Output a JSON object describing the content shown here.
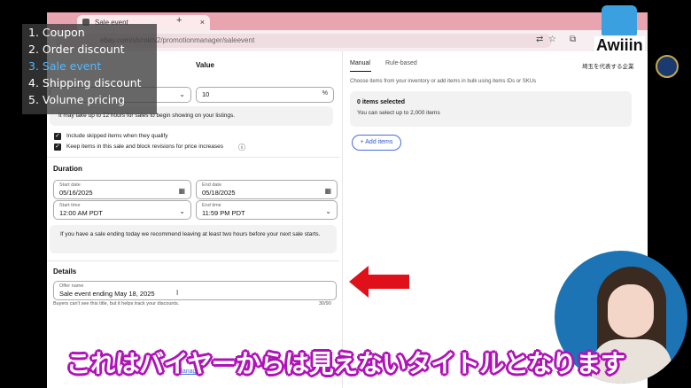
{
  "browser": {
    "tab_title": "Sale event",
    "tab_close": "×",
    "new_tab": "+",
    "url": "ebay.com/sh/mktv2/promotionmanager/saleevent",
    "icons": [
      "translate-icon",
      "star-icon",
      "extensions-icon"
    ]
  },
  "form": {
    "value_label": "Value",
    "value_input": "10",
    "value_unit": "%",
    "notice": "It may take up to 12 hours for sales to begin showing on your listings.",
    "checkboxes": [
      {
        "label": "Include skipped items when they qualify",
        "checked": true
      },
      {
        "label": "Keep items in this sale and block revisions for price increases",
        "checked": true,
        "info_icon": "ⓘ"
      }
    ],
    "duration": {
      "heading": "Duration",
      "start_date_label": "Start date",
      "start_date": "05/16/2025",
      "end_date_label": "End date",
      "end_date": "05/18/2025",
      "start_time_label": "Start time",
      "start_time": "12:00 AM PDT",
      "end_time_label": "End time",
      "end_time": "11:59 PM PDT",
      "tip": "If you have a sale ending today we recommend leaving at least two hours before your next sale starts."
    },
    "details": {
      "heading": "Details",
      "offer_name_label": "Offer name",
      "offer_name": "Sale event ending May 18, 2025",
      "helper": "Buyers can't see this title, but it helps track your discounts.",
      "counter": "30/90"
    }
  },
  "right_panel": {
    "tabs": [
      "Manual",
      "Rule-based"
    ],
    "active_tab": "Manual",
    "description": "Choose items from your inventory or add items in bulk using items IDs or SKUs",
    "items_title": "0 items selected",
    "items_sub": "You can select up to 2,000 items",
    "add_button": "+ Add items"
  },
  "overlay_list": {
    "items": [
      "1. Coupon",
      "2. Order discount",
      "3. Sale event",
      "4. Shipping discount",
      "5. Volume pricing"
    ],
    "active_index": 2,
    "active_color": "#52b8ff"
  },
  "logo": {
    "name": "Awiiin",
    "tagline": "埼玉を代表する企業"
  },
  "subtitle": "これはバイヤーからは見えないタイトルとなります",
  "bottom_link": "Manager",
  "colors": {
    "subtitle_outline": "#b012b8",
    "arrow": "#e0101a",
    "link_blue": "#3355cc",
    "tab_bar": "#e8a5b0"
  }
}
